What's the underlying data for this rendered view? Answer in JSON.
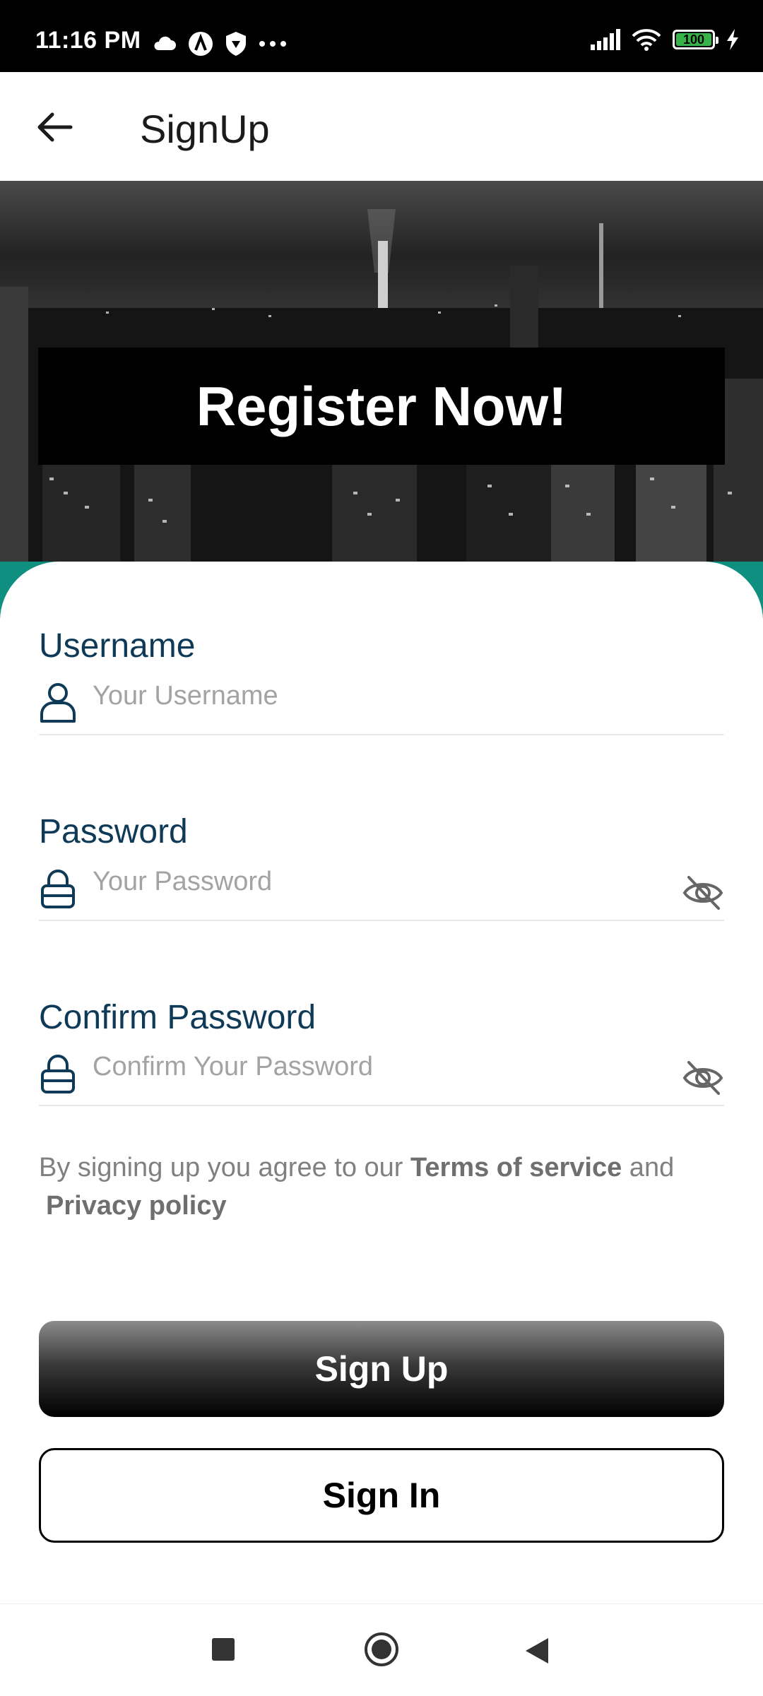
{
  "status_bar": {
    "time": "11:16 PM",
    "battery": "100",
    "icons": [
      "cloud-icon",
      "a-logo-icon",
      "shield-icon",
      "more-dots-icon",
      "signal-icon",
      "wifi-icon",
      "battery-icon",
      "charging-bolt-icon"
    ]
  },
  "app_bar": {
    "title": "SignUp",
    "back_icon": "arrow-left-icon"
  },
  "hero": {
    "banner_text": "Register Now!"
  },
  "form": {
    "username": {
      "label": "Username",
      "placeholder": "Your Username",
      "icon": "user-icon"
    },
    "password": {
      "label": "Password",
      "placeholder": "Your Password",
      "icon": "lock-icon",
      "toggle_icon": "eye-off-icon"
    },
    "confirm": {
      "label": "Confirm Password",
      "placeholder": "Confirm Your Password",
      "icon": "lock-icon",
      "toggle_icon": "eye-off-icon"
    }
  },
  "terms": {
    "prefix": "By signing up you agree to our ",
    "terms_link": "Terms of service",
    "middle": " and",
    "privacy_link": "Privacy policy"
  },
  "buttons": {
    "signup": "Sign Up",
    "signin": "Sign In"
  },
  "colors": {
    "accent": "#0f3a57",
    "teal": "#0e8f80",
    "placeholder": "#a3a3a3"
  }
}
